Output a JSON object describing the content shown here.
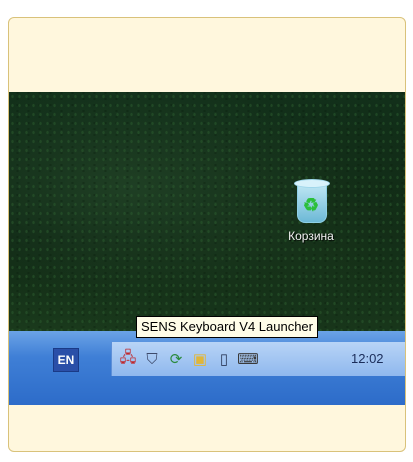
{
  "desktop": {
    "recycle_bin": {
      "label": "Корзина",
      "icon": "recycle-bin-icon"
    }
  },
  "tooltip": {
    "text": "SENS Keyboard V4 Launcher"
  },
  "taskbar": {
    "language": "EN",
    "tray_icons": [
      "network-disconnected-icon",
      "security-shield-icon",
      "update-icon",
      "display-icon",
      "mobile-device-icon",
      "keyboard-launcher-icon"
    ],
    "clock": "12:02"
  },
  "colors": {
    "desktop_bg": "#12301a",
    "taskbar": "#3f7fd6",
    "tray": "#9fc2f0",
    "tooltip_bg": "#fffde8",
    "card_bg": "#fff7dd"
  }
}
